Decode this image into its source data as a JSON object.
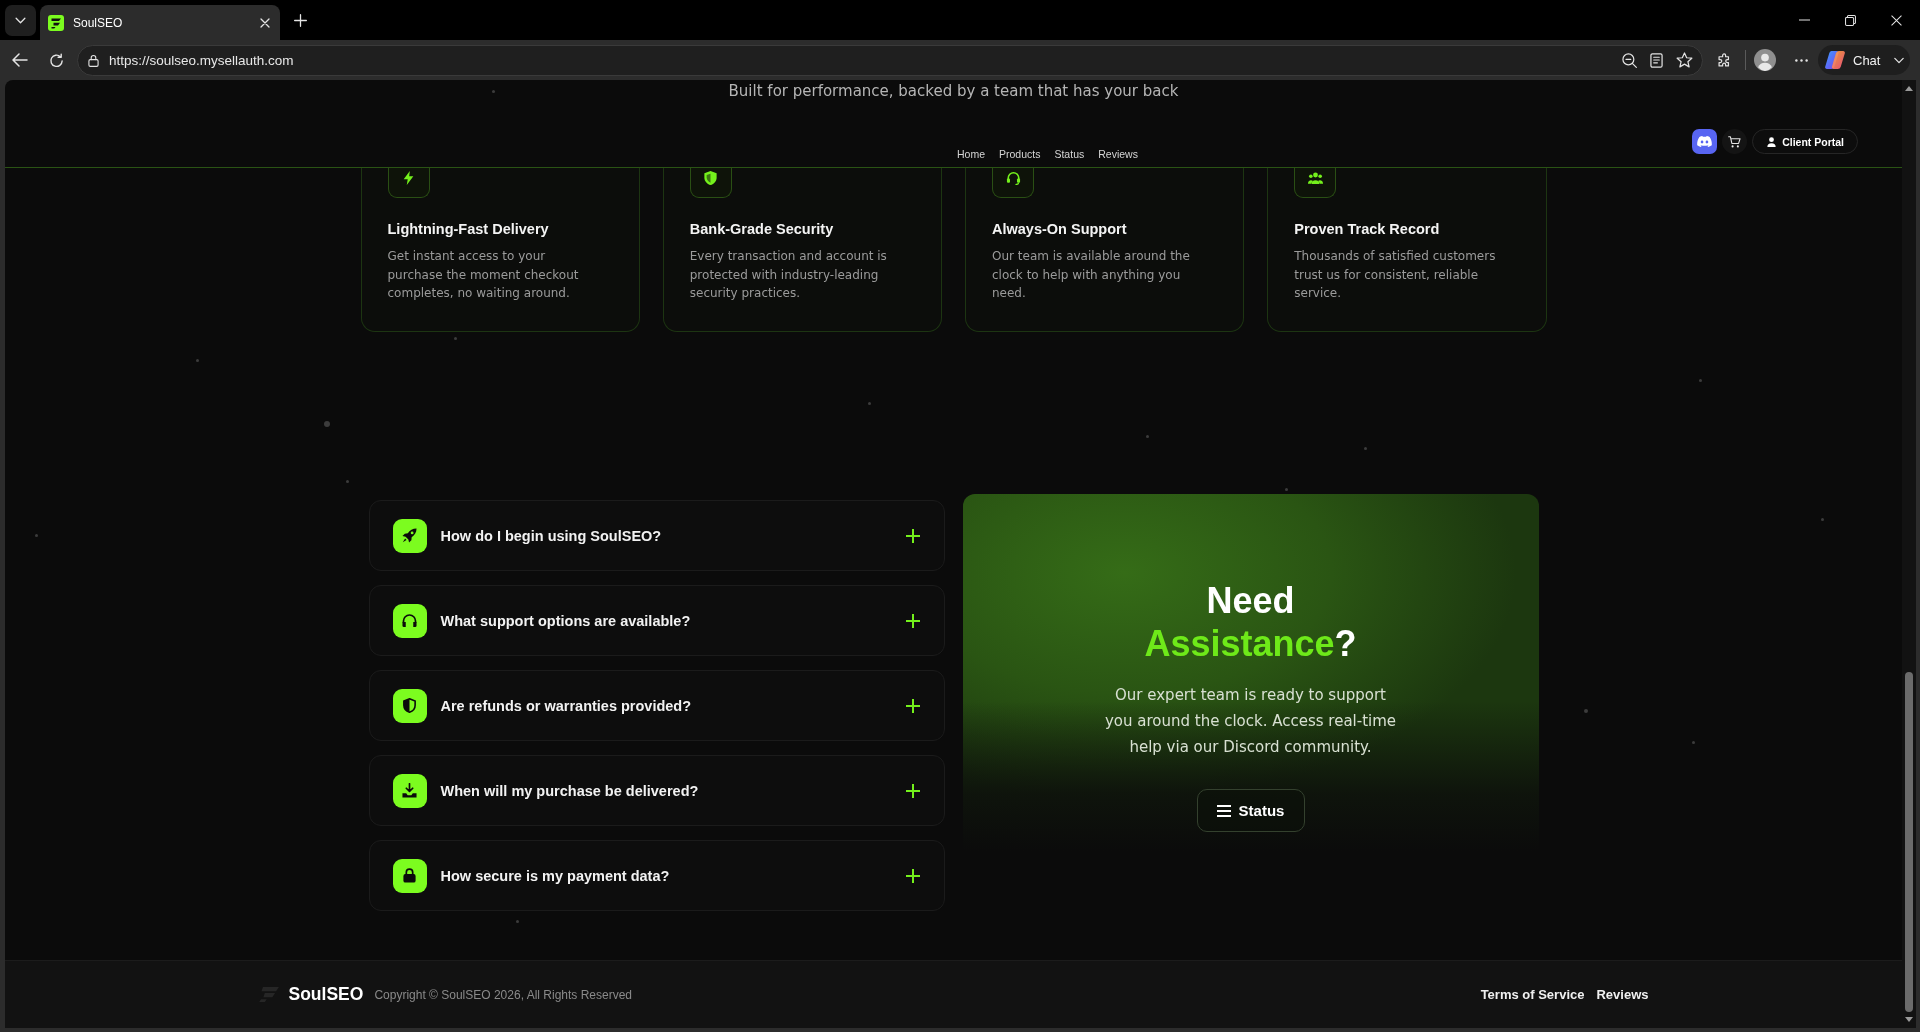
{
  "browser": {
    "tabs": [
      {
        "title": "SoulSEO",
        "selected": true
      }
    ],
    "url": "https://soulseo.mysellauth.com",
    "chat_label": "Chat"
  },
  "header": {
    "subtitle": "Built for performance, backed by a team that has your back",
    "nav": [
      {
        "label": "Home"
      },
      {
        "label": "Products"
      },
      {
        "label": "Status"
      },
      {
        "label": "Reviews"
      }
    ],
    "portal_button": "Client Portal"
  },
  "features": [
    {
      "title": "Lightning-Fast Delivery",
      "text": "Get instant access to your purchase the moment checkout completes, no waiting around."
    },
    {
      "title": "Bank-Grade Security",
      "text": "Every transaction and account is protected with industry-leading security practices."
    },
    {
      "title": "Always-On Support",
      "text": "Our team is available around the clock to help with anything you need."
    },
    {
      "title": "Proven Track Record",
      "text": "Thousands of satisfied customers trust us for consistent, reliable service."
    }
  ],
  "faq": [
    {
      "question": "How do I begin using SoulSEO?",
      "expanded": false
    },
    {
      "question": "What support options are available?",
      "expanded": false
    },
    {
      "question": "Are refunds or warranties provided?",
      "expanded": false
    },
    {
      "question": "When will my purchase be delivered?",
      "expanded": false
    },
    {
      "question": "How secure is my payment data?",
      "expanded": false
    }
  ],
  "assistance": {
    "title": [
      {
        "text": "Need ",
        "highlight": false
      },
      {
        "text": "Assistance",
        "highlight": true
      },
      {
        "text": "?",
        "highlight": false
      }
    ],
    "text": "Our expert team is ready to support you around the clock. Access real-time help via our Discord community.",
    "button": "Status"
  },
  "footer": {
    "brand": "SoulSEO",
    "copyright": "Copyright © SoulSEO 2026, All Rights Reserved",
    "links": [
      {
        "label": "Terms of Service"
      },
      {
        "label": "Reviews"
      }
    ]
  }
}
